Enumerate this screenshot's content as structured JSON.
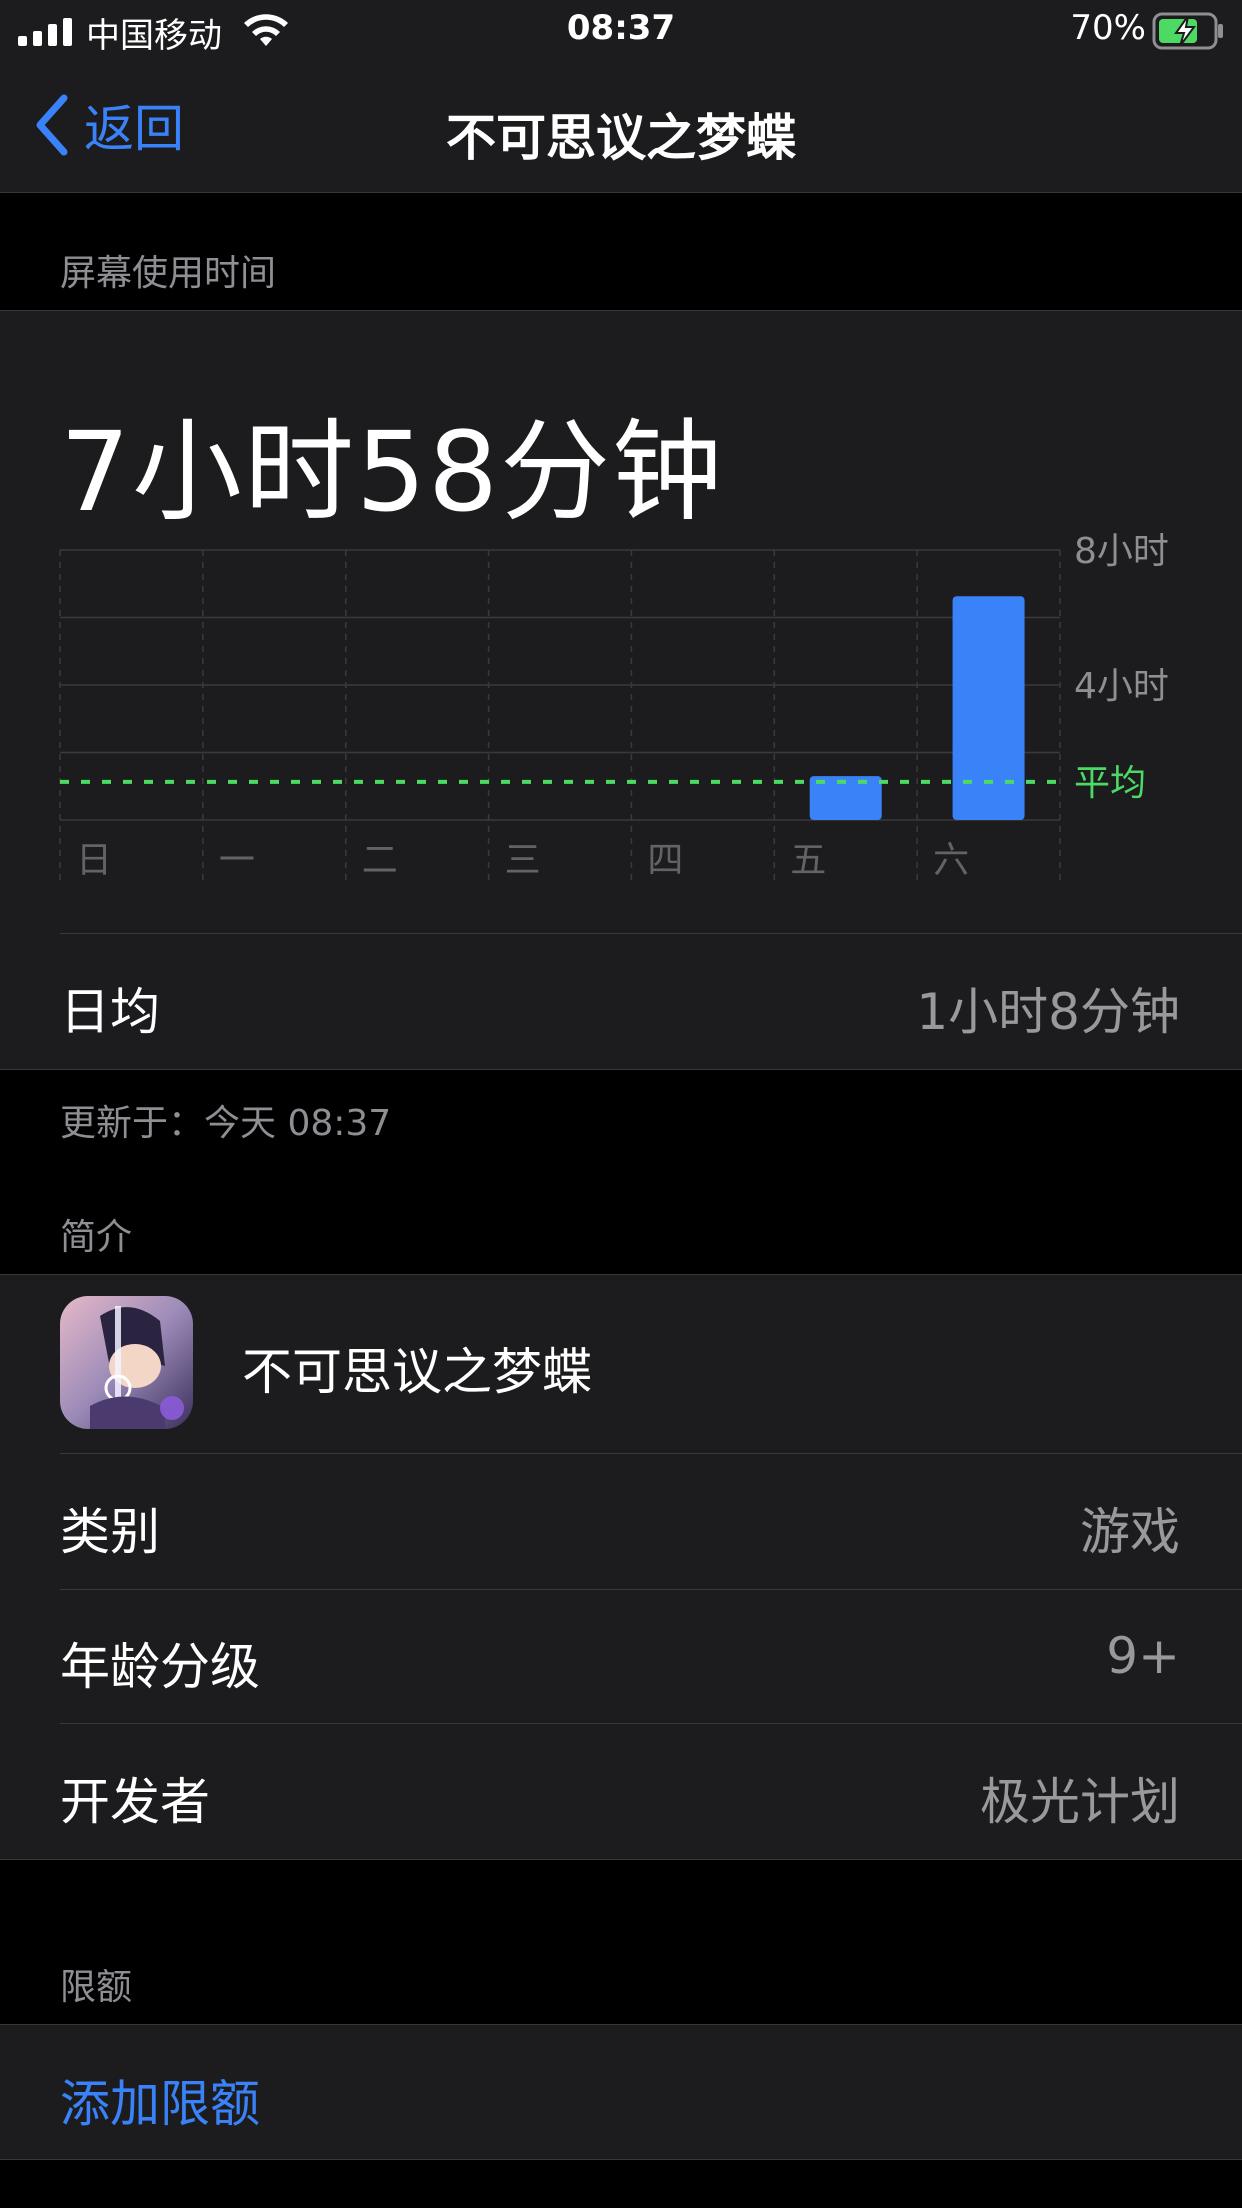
{
  "status_bar": {
    "carrier": "中国移动",
    "time": "08:37",
    "battery_percent": "70%"
  },
  "nav": {
    "back_label": "返回",
    "title": "不可思议之梦蝶"
  },
  "screen_time": {
    "section_header": "屏幕使用时间",
    "total": "7小时58分钟",
    "daily_average_label": "日均",
    "daily_average_value": "1小时8分钟",
    "updated": "更新于：今天 08:37"
  },
  "chart_data": {
    "type": "bar",
    "categories": [
      "日",
      "一",
      "二",
      "三",
      "四",
      "五",
      "六"
    ],
    "values_hours": [
      0,
      0,
      0,
      0,
      0,
      1.3,
      6.63
    ],
    "ylim": [
      0,
      8
    ],
    "y_ticks": [
      {
        "value": 8,
        "label": "8小时"
      },
      {
        "value": 4,
        "label": "4小时"
      }
    ],
    "average": {
      "value": 1.13,
      "label": "平均"
    },
    "bar_color": "#3a82f7",
    "average_color": "#4cd964",
    "grid": true
  },
  "about": {
    "section_header": "简介",
    "app_name": "不可思议之梦蝶",
    "rows": [
      {
        "label": "类别",
        "value": "游戏"
      },
      {
        "label": "年龄分级",
        "value": "9+"
      },
      {
        "label": "开发者",
        "value": "极光计划"
      }
    ]
  },
  "limits": {
    "section_header": "限额",
    "add_label": "添加限额"
  },
  "colors": {
    "accent": "#3a82f7",
    "background": "#000000",
    "card": "#1c1c1e"
  }
}
